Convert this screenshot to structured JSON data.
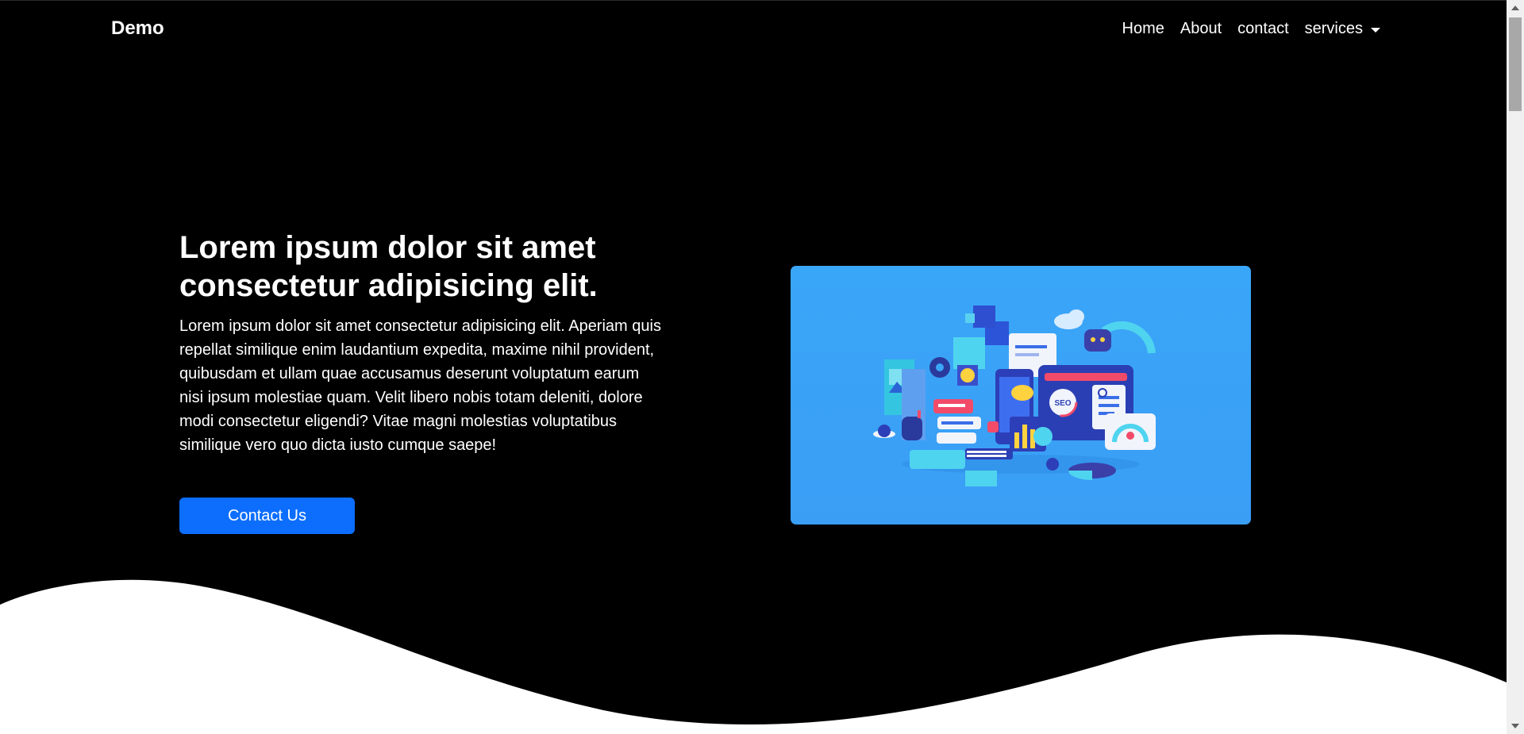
{
  "navbar": {
    "brand": "Demo",
    "items": [
      {
        "label": "Home"
      },
      {
        "label": "About"
      },
      {
        "label": "contact"
      },
      {
        "label": "services",
        "dropdown": true
      }
    ]
  },
  "hero": {
    "title": "Lorem ipsum dolor sit amet consectetur adipisicing elit.",
    "paragraph": "Lorem ipsum dolor sit amet consectetur adipisicing elit. Aperiam quis repellat similique enim laudantium expedita, maxime nihil provident, quibusdam et ullam quae accusamus deserunt voluptatum earum nisi ipsum molestiae quam. Velit libero nobis totam deleniti, dolore modi consectetur eligendi? Vitae magni molestias voluptatibus similique vero quo dicta iusto cumque saepe!",
    "button_label": "Contact Us",
    "illustration_badge": "SEO"
  },
  "colors": {
    "background": "#000000",
    "primary_button": "#0d6efd",
    "illustration_bg": "#3aa6f8",
    "wave": "#ffffff"
  },
  "icons": [
    "chevron-down-icon",
    "seo-illustration"
  ]
}
